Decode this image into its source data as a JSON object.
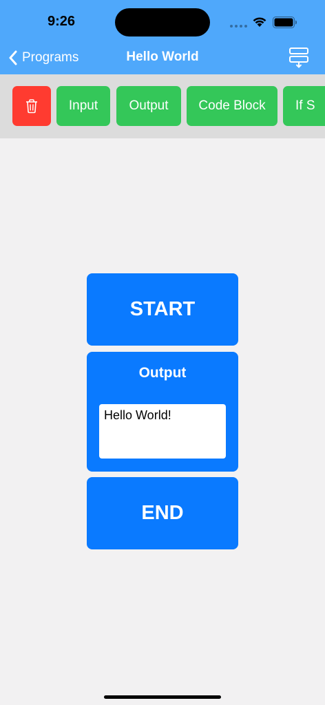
{
  "status_bar": {
    "time": "9:26"
  },
  "nav": {
    "back_label": "Programs",
    "title": "Hello World",
    "action_icon": "export-layers-icon"
  },
  "toolbar": {
    "delete_icon": "trash-icon",
    "buttons": [
      {
        "label": "Input"
      },
      {
        "label": "Output"
      },
      {
        "label": "Code Block"
      },
      {
        "label": "If S"
      }
    ]
  },
  "canvas": {
    "start_label": "START",
    "output_block": {
      "title": "Output",
      "value": "Hello World!"
    },
    "end_label": "END"
  },
  "colors": {
    "nav_bar": "#4fa8fb",
    "toolbar_bg": "#dcdcdc",
    "green_button": "#34c759",
    "delete_button": "#ff3b30",
    "block_blue": "#0a7aff",
    "canvas_bg": "#f2f1f2"
  }
}
